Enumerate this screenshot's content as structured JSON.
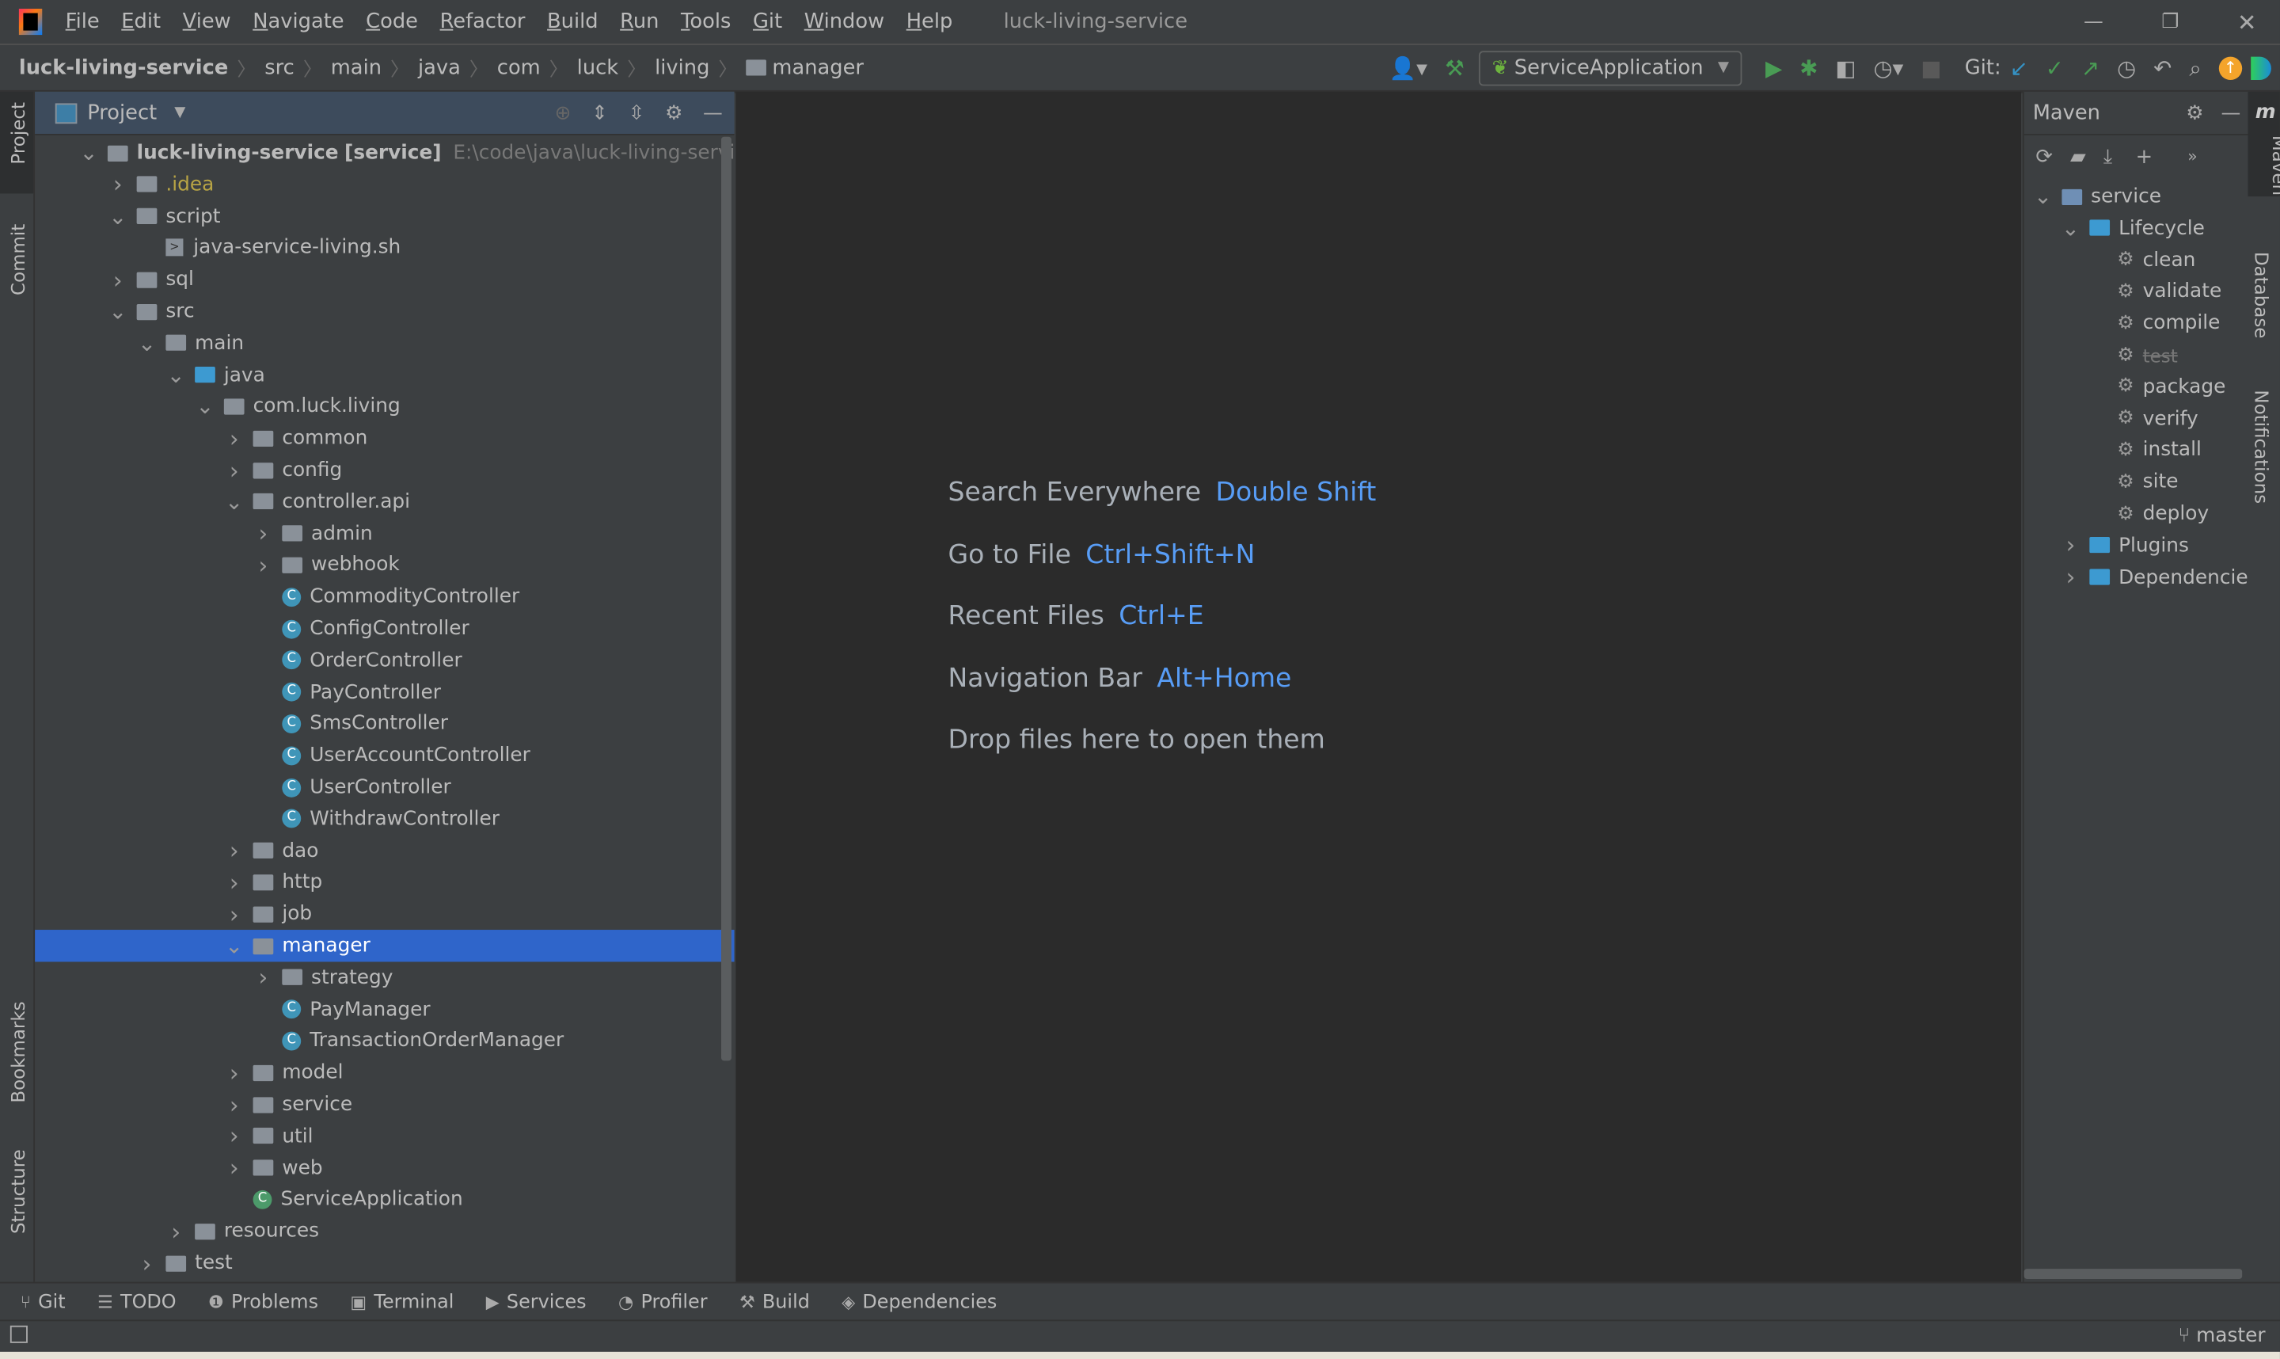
{
  "app": {
    "title": "luck-living-service"
  },
  "menu": [
    "File",
    "Edit",
    "View",
    "Navigate",
    "Code",
    "Refactor",
    "Build",
    "Run",
    "Tools",
    "Git",
    "Window",
    "Help"
  ],
  "breadcrumb": [
    "luck-living-service",
    "src",
    "main",
    "java",
    "com",
    "luck",
    "living",
    "manager"
  ],
  "toolbar": {
    "run_config": "ServiceApplication",
    "git_label": "Git:"
  },
  "left_strip": [
    "Project",
    "Commit",
    "Bookmarks",
    "Structure"
  ],
  "right_strip": [
    "Maven",
    "Database",
    "Notifications"
  ],
  "project": {
    "title": "Project",
    "root_module": "[service]",
    "root_path": "E:\\code\\java\\luck-living-service",
    "tree": [
      {
        "level": 0,
        "kind": "module",
        "label": "luck-living-service",
        "expanded": true
      },
      {
        "level": 1,
        "kind": "folder",
        "label": ".idea",
        "expanded": false,
        "color": "#b8a445"
      },
      {
        "level": 1,
        "kind": "folder",
        "label": "script",
        "expanded": true
      },
      {
        "level": 2,
        "kind": "script",
        "label": "java-service-living.sh"
      },
      {
        "level": 1,
        "kind": "folder",
        "label": "sql",
        "expanded": false
      },
      {
        "level": 1,
        "kind": "folder",
        "label": "src",
        "expanded": true
      },
      {
        "level": 2,
        "kind": "folder",
        "label": "main",
        "expanded": true
      },
      {
        "level": 3,
        "kind": "srcfolder",
        "label": "java",
        "expanded": true
      },
      {
        "level": 4,
        "kind": "package",
        "label": "com.luck.living",
        "expanded": true
      },
      {
        "level": 5,
        "kind": "package",
        "label": "common",
        "expanded": false
      },
      {
        "level": 5,
        "kind": "package",
        "label": "config",
        "expanded": false
      },
      {
        "level": 5,
        "kind": "package",
        "label": "controller.api",
        "expanded": true
      },
      {
        "level": 6,
        "kind": "package",
        "label": "admin",
        "expanded": false
      },
      {
        "level": 6,
        "kind": "package",
        "label": "webhook",
        "expanded": false
      },
      {
        "level": 6,
        "kind": "class",
        "label": "CommodityController"
      },
      {
        "level": 6,
        "kind": "class",
        "label": "ConfigController"
      },
      {
        "level": 6,
        "kind": "class",
        "label": "OrderController"
      },
      {
        "level": 6,
        "kind": "class",
        "label": "PayController"
      },
      {
        "level": 6,
        "kind": "class",
        "label": "SmsController"
      },
      {
        "level": 6,
        "kind": "class",
        "label": "UserAccountController"
      },
      {
        "level": 6,
        "kind": "class",
        "label": "UserController"
      },
      {
        "level": 6,
        "kind": "class",
        "label": "WithdrawController"
      },
      {
        "level": 5,
        "kind": "package",
        "label": "dao",
        "expanded": false
      },
      {
        "level": 5,
        "kind": "package",
        "label": "http",
        "expanded": false
      },
      {
        "level": 5,
        "kind": "package",
        "label": "job",
        "expanded": false
      },
      {
        "level": 5,
        "kind": "package",
        "label": "manager",
        "expanded": true,
        "selected": true
      },
      {
        "level": 6,
        "kind": "package",
        "label": "strategy",
        "expanded": false
      },
      {
        "level": 6,
        "kind": "class",
        "label": "PayManager"
      },
      {
        "level": 6,
        "kind": "class",
        "label": "TransactionOrderManager"
      },
      {
        "level": 5,
        "kind": "package",
        "label": "model",
        "expanded": false
      },
      {
        "level": 5,
        "kind": "package",
        "label": "service",
        "expanded": false
      },
      {
        "level": 5,
        "kind": "package",
        "label": "util",
        "expanded": false
      },
      {
        "level": 5,
        "kind": "package",
        "label": "web",
        "expanded": false
      },
      {
        "level": 5,
        "kind": "springclass",
        "label": "ServiceApplication"
      },
      {
        "level": 3,
        "kind": "resfolder",
        "label": "resources",
        "expanded": false
      },
      {
        "level": 2,
        "kind": "folder",
        "label": "test",
        "expanded": false
      }
    ]
  },
  "editor": {
    "hints": [
      {
        "label": "Search Everywhere",
        "key": "Double Shift"
      },
      {
        "label": "Go to File",
        "key": "Ctrl+Shift+N"
      },
      {
        "label": "Recent Files",
        "key": "Ctrl+E"
      },
      {
        "label": "Navigation Bar",
        "key": "Alt+Home"
      },
      {
        "label": "Drop files here to open them",
        "key": ""
      }
    ]
  },
  "maven": {
    "title": "Maven",
    "tree": [
      {
        "level": 0,
        "kind": "project",
        "label": "service",
        "expanded": true
      },
      {
        "level": 1,
        "kind": "group",
        "label": "Lifecycle",
        "expanded": true
      },
      {
        "level": 2,
        "kind": "goal",
        "label": "clean"
      },
      {
        "level": 2,
        "kind": "goal",
        "label": "validate"
      },
      {
        "level": 2,
        "kind": "goal",
        "label": "compile"
      },
      {
        "level": 2,
        "kind": "goal",
        "label": "test",
        "skipped": true
      },
      {
        "level": 2,
        "kind": "goal",
        "label": "package"
      },
      {
        "level": 2,
        "kind": "goal",
        "label": "verify"
      },
      {
        "level": 2,
        "kind": "goal",
        "label": "install"
      },
      {
        "level": 2,
        "kind": "goal",
        "label": "site"
      },
      {
        "level": 2,
        "kind": "goal",
        "label": "deploy"
      },
      {
        "level": 1,
        "kind": "group",
        "label": "Plugins",
        "expanded": false
      },
      {
        "level": 1,
        "kind": "group",
        "label": "Dependencies",
        "expanded": false
      }
    ]
  },
  "bottom_tabs": [
    {
      "icon": "git-branch-icon",
      "glyph": "⑂",
      "label": "Git"
    },
    {
      "icon": "todo-icon",
      "glyph": "☰",
      "label": "TODO"
    },
    {
      "icon": "problems-icon",
      "glyph": "❶",
      "label": "Problems"
    },
    {
      "icon": "terminal-icon",
      "glyph": "▣",
      "label": "Terminal"
    },
    {
      "icon": "services-icon",
      "glyph": "▶",
      "label": "Services"
    },
    {
      "icon": "profiler-icon",
      "glyph": "◔",
      "label": "Profiler"
    },
    {
      "icon": "build-icon",
      "glyph": "⚒",
      "label": "Build"
    },
    {
      "icon": "dependencies-icon",
      "glyph": "◈",
      "label": "Dependencies"
    }
  ],
  "status": {
    "branch": "master"
  },
  "colors": {
    "accent": "#2f65ca",
    "run": "#499c54",
    "link": "#589df6"
  }
}
